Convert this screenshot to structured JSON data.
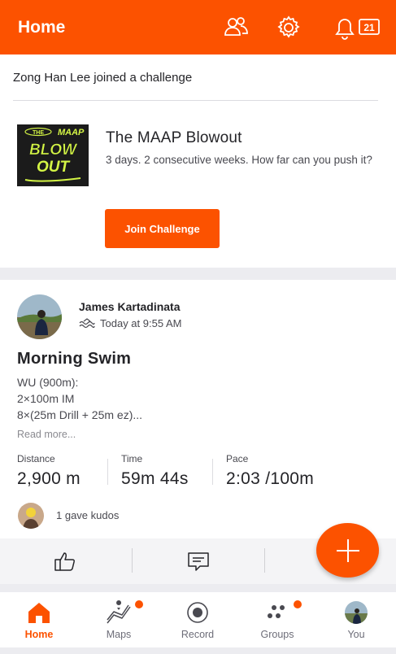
{
  "header": {
    "title": "Home",
    "notification_count": "21",
    "icons": [
      "people-icon",
      "gear-icon",
      "bell-icon"
    ]
  },
  "challenge_card": {
    "joined_text": "Zong Han Lee joined a challenge",
    "logo_lines": [
      "THE",
      "MAAP",
      "BLOW",
      "OUT"
    ],
    "title": "The MAAP Blowout",
    "description": "3 days. 2 consecutive weeks. How far can you push it?",
    "button_label": "Join Challenge"
  },
  "activity": {
    "athlete": "James Kartadinata",
    "time": "Today at 9:55 AM",
    "title": "Morning Swim",
    "description_lines": [
      "WU (900m):",
      "2×100m IM",
      "8×(25m Drill + 25m ez)..."
    ],
    "read_more": "Read more...",
    "stats": [
      {
        "label": "Distance",
        "value": "2,900 m"
      },
      {
        "label": "Time",
        "value": "59m 44s"
      },
      {
        "label": "Pace",
        "value": "2:03 /100m"
      }
    ],
    "kudos": "1 gave kudos"
  },
  "nav": {
    "items": [
      {
        "label": "Home",
        "icon": "home-icon"
      },
      {
        "label": "Maps",
        "icon": "map-icon"
      },
      {
        "label": "Record",
        "icon": "record-icon"
      },
      {
        "label": "Groups",
        "icon": "groups-icon"
      },
      {
        "label": "You",
        "icon": "avatar"
      }
    ]
  },
  "colors": {
    "accent": "#fc5200",
    "logo_green": "#d4f545"
  }
}
